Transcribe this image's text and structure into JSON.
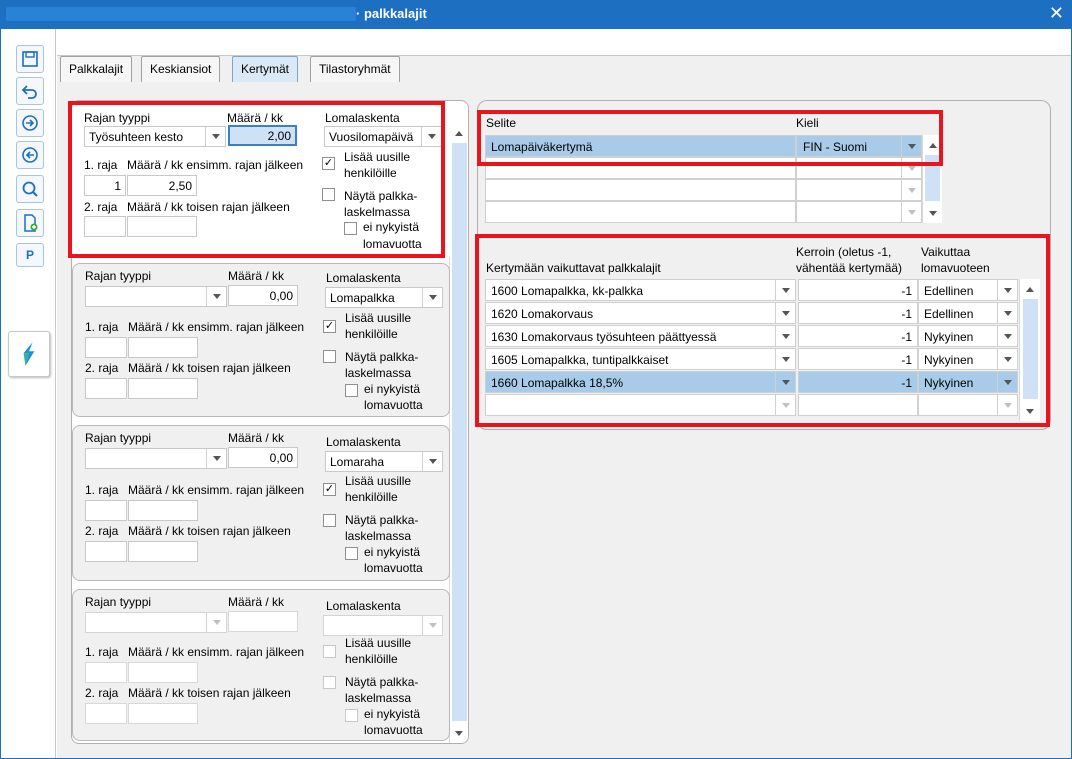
{
  "window": {
    "title": "· palkkalajit",
    "close_icon": "close-icon"
  },
  "tabs": [
    {
      "label": "Palkkalajit",
      "active": false
    },
    {
      "label": "Keskiansiot",
      "active": false
    },
    {
      "label": "Kertymät",
      "active": true
    },
    {
      "label": "Tilastoryhmät",
      "active": false
    }
  ],
  "toolbar": {
    "buttons": [
      "save-icon",
      "undo-icon",
      "forward-icon",
      "back-icon",
      "search-icon",
      "new-document-icon"
    ],
    "p_label": "P",
    "brand_icon": "app-logo-icon"
  },
  "labels": {
    "rajan_tyyppi": "Rajan tyyppi",
    "maara_kk": "Määrä / kk",
    "lomalaskenta": "Lomalaskenta",
    "raja1": "1. raja",
    "maara_ensimm": "Määrä / kk ensimm. rajan jälkeen",
    "raja2": "2. raja",
    "maara_toisen": "Määrä / kk toisen rajan jälkeen",
    "lisaa_uusille": "Lisää uusille",
    "henkiloille": "henkilöille",
    "nayta_palkka": "Näytä palkka-",
    "laskelmassa": "laskelmassa",
    "ei_nykyista": "ei nykyistä",
    "lomavuotta": "lomavuotta"
  },
  "groups": [
    {
      "rajan_tyyppi": "Työsuhteen kesto",
      "maara": "2,00",
      "lomalaskenta": "Vuosilomapäivä",
      "raja1": "1",
      "maara1": "2,50",
      "raja2": "",
      "maara2": "",
      "lisaa_checked": "✓",
      "nayta_checked": "",
      "ei_nyk_checked": "",
      "enabled": true
    },
    {
      "rajan_tyyppi": "",
      "maara": "0,00",
      "lomalaskenta": "Lomapalkka",
      "raja1": "",
      "maara1": "",
      "raja2": "",
      "maara2": "",
      "lisaa_checked": "✓",
      "nayta_checked": "",
      "ei_nyk_checked": "",
      "enabled": true
    },
    {
      "rajan_tyyppi": "",
      "maara": "0,00",
      "lomalaskenta": "Lomaraha",
      "raja1": "",
      "maara1": "",
      "raja2": "",
      "maara2": "",
      "lisaa_checked": "✓",
      "nayta_checked": "",
      "ei_nyk_checked": "",
      "enabled": true
    },
    {
      "rajan_tyyppi": "",
      "maara": "",
      "lomalaskenta": "",
      "raja1": "",
      "maara1": "",
      "raja2": "",
      "maara2": "",
      "lisaa_checked": "",
      "nayta_checked": "",
      "ei_nyk_checked": "",
      "enabled": false
    }
  ],
  "selite_table": {
    "col_selite": "Selite",
    "col_kieli": "Kieli",
    "rows": [
      {
        "selite": "Lomapäiväkertymä",
        "kieli": "FIN - Suomi"
      },
      {
        "selite": "",
        "kieli": ""
      },
      {
        "selite": "",
        "kieli": ""
      },
      {
        "selite": "",
        "kieli": ""
      }
    ]
  },
  "kertyma_table": {
    "col_palkkalajit": "Kertymään vaikuttavat palkkalajit",
    "col_kerroin": "Kerroin (oletus -1,",
    "col_kerroin2": "vähentää kertymää)",
    "col_vaikuttaa": "Vaikuttaa",
    "col_vaikuttaa2": "lomavuoteen",
    "rows": [
      {
        "palkkalaji": "1600 Lomapalkka, kk-palkka",
        "kerroin": "-1",
        "vaikuttaa": "Edellinen"
      },
      {
        "palkkalaji": "1620 Lomakorvaus",
        "kerroin": "-1",
        "vaikuttaa": "Edellinen"
      },
      {
        "palkkalaji": "1630 Lomakorvaus työsuhteen päättyessä",
        "kerroin": "-1",
        "vaikuttaa": "Nykyinen"
      },
      {
        "palkkalaji": "1605 Lomapalkka, tuntipalkkaiset",
        "kerroin": "-1",
        "vaikuttaa": "Nykyinen"
      },
      {
        "palkkalaji": "1660 Lomapalkka 18,5%",
        "kerroin": "-1",
        "vaikuttaa": "Nykyinen"
      },
      {
        "palkkalaji": "",
        "kerroin": "",
        "vaikuttaa": ""
      }
    ]
  },
  "colors": {
    "titlebar": "#1d6fc2",
    "selection": "#a7cbe9",
    "highlight_box": "#e8141e"
  }
}
